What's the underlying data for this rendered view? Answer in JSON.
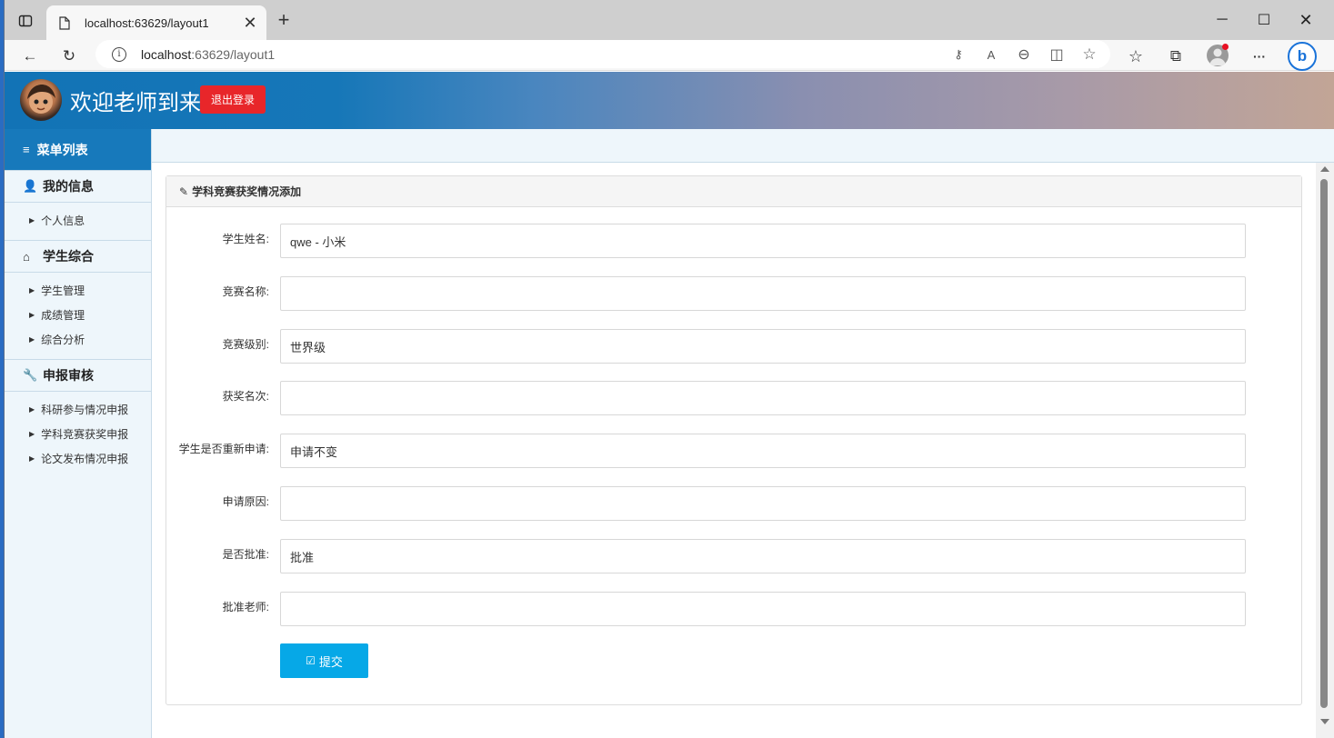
{
  "browser": {
    "tab_title": "localhost:63629/layout1",
    "url_host": "localhost",
    "url_path": ":63629/layout1",
    "icons": [
      "tab-actions-icon",
      "page-icon",
      "close-icon",
      "plus-icon",
      "minimize-icon",
      "maximize-icon",
      "window-close-icon",
      "back-arrow-icon",
      "refresh-icon",
      "info-icon",
      "key-icon",
      "read-aloud-icon",
      "zoom-out-icon",
      "split-screen-icon",
      "add-favorite-icon",
      "favorites-icon",
      "collections-icon",
      "profile-icon",
      "more-icon",
      "bing-icon"
    ],
    "glyphs": {
      "tab_close": "✕",
      "new_tab": "+",
      "minimize": "─",
      "maximize": "☐",
      "window_close": "✕",
      "back": "←",
      "refresh": "↻",
      "info": "i",
      "key": "⚷",
      "read_aloud": "A",
      "read_aloud_sup": "ᐧ",
      "zoom_out": "⊖",
      "split": "◫",
      "add_favorite": "☆",
      "favorites": "☆",
      "collections": "⧉",
      "more": "···",
      "bing": "b"
    }
  },
  "header": {
    "welcome": "欢迎老师到来",
    "logout": "退出登录"
  },
  "sidebar": {
    "title": "菜单列表",
    "title_icon": "≡",
    "caret": "▶",
    "groups": [
      {
        "label": "我的信息",
        "icon": "user-icon",
        "glyph": "👤",
        "items": [
          {
            "label": "个人信息"
          }
        ]
      },
      {
        "label": "学生综合",
        "icon": "home-icon",
        "glyph": "⌂",
        "items": [
          {
            "label": "学生管理"
          },
          {
            "label": "成绩管理"
          },
          {
            "label": "综合分析"
          }
        ]
      },
      {
        "label": "申报审核",
        "icon": "wrench-icon",
        "glyph": "🔧",
        "items": [
          {
            "label": "科研参与情况申报"
          },
          {
            "label": "学科竞赛获奖申报"
          },
          {
            "label": "论文发布情况申报"
          }
        ]
      }
    ]
  },
  "form": {
    "title": "学科竞赛获奖情况添加",
    "title_icon": "✎",
    "fields": [
      {
        "label": "学生姓名:",
        "value": "qwe - 小米"
      },
      {
        "label": "竞赛名称:",
        "value": ""
      },
      {
        "label": "竞赛级别:",
        "value": "世界级"
      },
      {
        "label": "获奖名次:",
        "value": ""
      },
      {
        "label": "学生是否重新申请:",
        "value": "申请不变"
      },
      {
        "label": "申请原因:",
        "value": ""
      },
      {
        "label": "是否批准:",
        "value": "批准"
      },
      {
        "label": "批准老师:",
        "value": ""
      }
    ],
    "submit_label": "提交",
    "submit_icon": "☑"
  },
  "colors": {
    "accent": "#1779bb",
    "logout": "#e8262a",
    "submit": "#06a8e7"
  }
}
